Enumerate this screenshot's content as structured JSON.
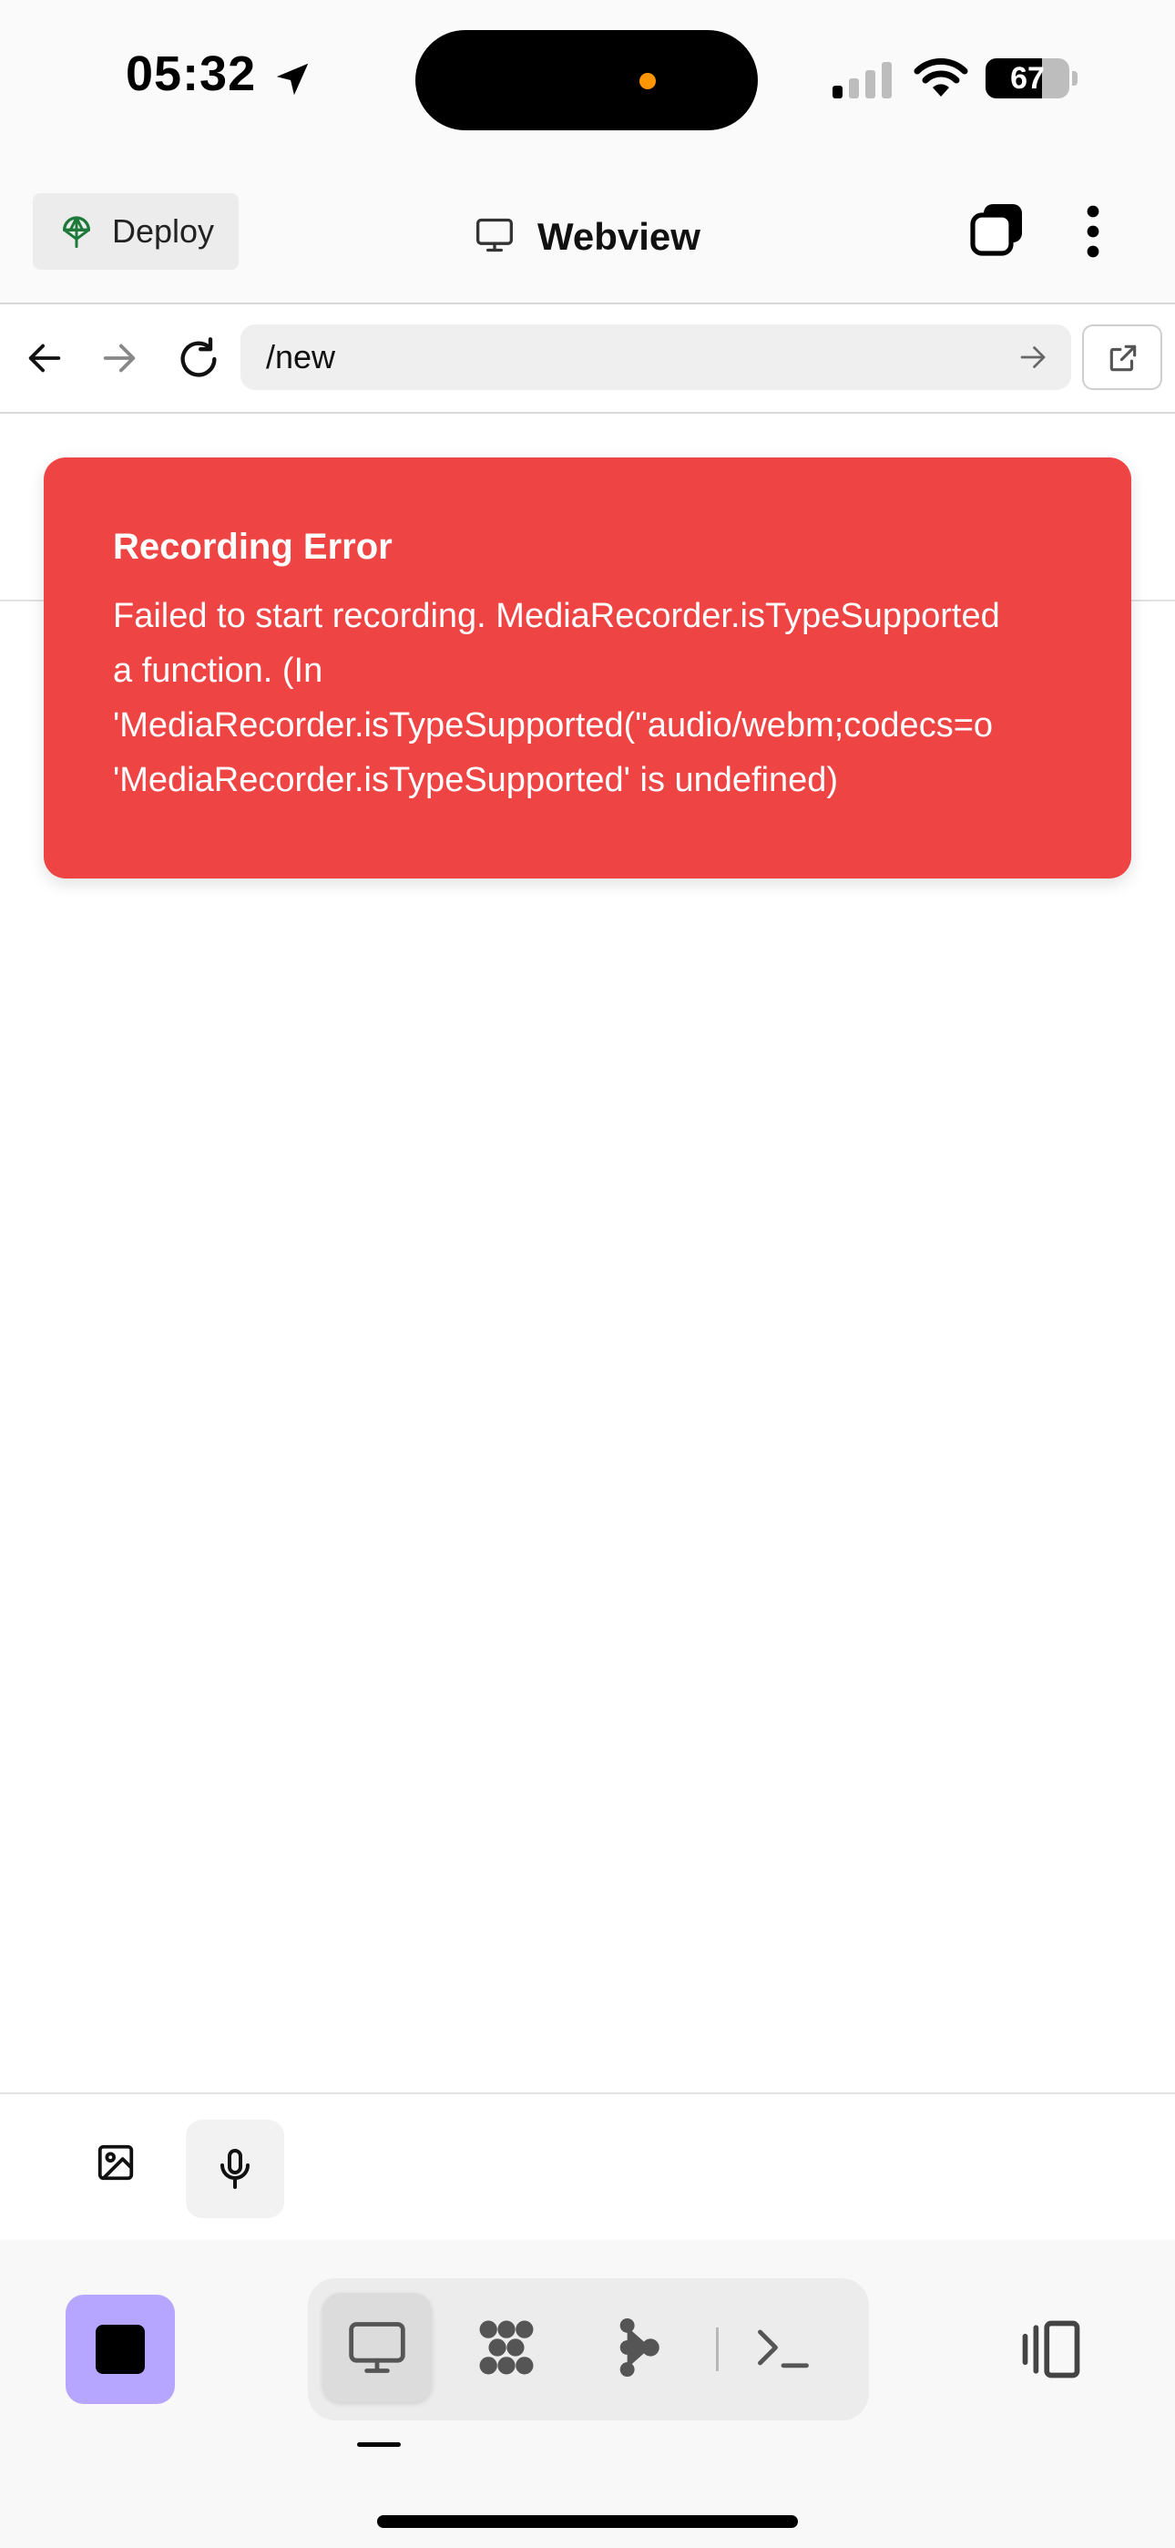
{
  "status_bar": {
    "time": "05:32",
    "battery_percent": 67,
    "battery_label": "67",
    "icons": [
      "location-arrow-icon",
      "cellular-signal-icon",
      "wifi-icon",
      "battery-icon"
    ]
  },
  "header": {
    "deploy_label": "Deploy",
    "title": "Webview",
    "icons": [
      "deploy-icon",
      "monitor-icon",
      "tabs-icon",
      "more-vertical-icon"
    ]
  },
  "url_bar": {
    "url": "/new",
    "icons": [
      "arrow-left-icon",
      "arrow-right-icon",
      "reload-icon",
      "arrow-right-icon",
      "external-link-icon"
    ]
  },
  "error_toast": {
    "title": "Recording Error",
    "message_lines": [
      "Failed to start recording. MediaRecorder.isTypeSupported",
      "a function. (In",
      "'MediaRecorder.isTypeSupported(\"audio/webm;codecs=o",
      "'MediaRecorder.isTypeSupported' is undefined)"
    ],
    "background_color": "#ef4444"
  },
  "composer": {
    "icons": [
      "image-icon",
      "microphone-icon"
    ]
  },
  "bottom_toolbar": {
    "stop_button_color": "#b7a6ff",
    "view_tabs": [
      {
        "icon": "monitor-icon",
        "active": true
      },
      {
        "icon": "dots-grid-icon",
        "active": false
      },
      {
        "icon": "branch-nodes-icon",
        "active": false
      },
      {
        "icon": "terminal-icon",
        "active": false
      }
    ],
    "icons": [
      "stop-icon",
      "panel-toggle-icon"
    ]
  },
  "colors": {
    "accent_purple": "#b7a6ff",
    "error_red": "#ef4444",
    "deploy_green": "#1f7a3a"
  }
}
